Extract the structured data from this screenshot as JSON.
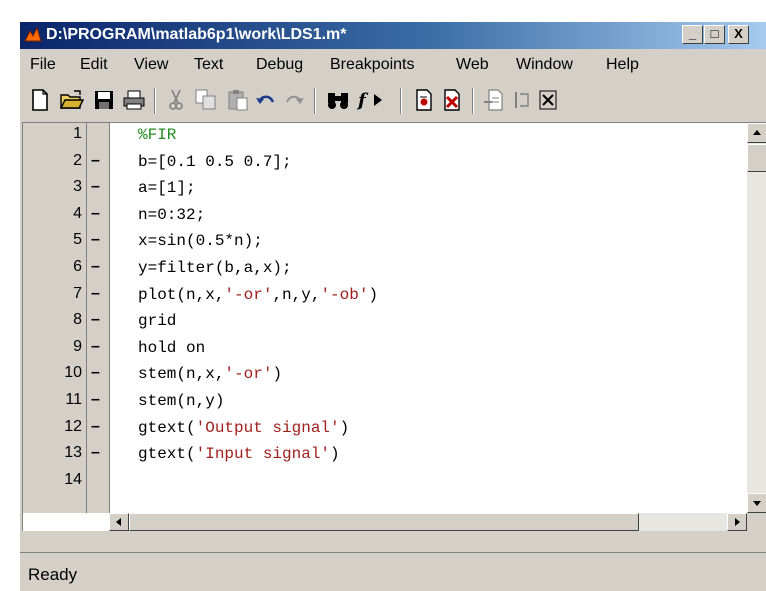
{
  "window": {
    "title": "D:\\PROGRAM\\matlab6p1\\work\\LDS1.m*",
    "minimize_label": "_",
    "maximize_label": "□",
    "close_label": "X"
  },
  "menu": [
    {
      "label": "File"
    },
    {
      "label": "Edit"
    },
    {
      "label": "View"
    },
    {
      "label": "Text"
    },
    {
      "label": "Debug"
    },
    {
      "label": "Breakpoints"
    },
    {
      "label": "Web"
    },
    {
      "label": "Window"
    },
    {
      "label": "Help"
    }
  ],
  "toolbar": {
    "buttons": [
      "new-file",
      "open-folder",
      "save",
      "print",
      "cut",
      "copy",
      "paste",
      "undo",
      "redo",
      "find",
      "function",
      "set-breakpoint",
      "clear-breakpoint",
      "step-in",
      "step-out"
    ]
  },
  "editor": {
    "lines": [
      {
        "num": "1",
        "mark": "",
        "code": [
          {
            "t": "%FIR",
            "c": "cmt"
          }
        ]
      },
      {
        "num": "2",
        "mark": "–",
        "code": [
          {
            "t": "b=[0.1 0.5 0.7];",
            "c": ""
          }
        ]
      },
      {
        "num": "3",
        "mark": "–",
        "code": [
          {
            "t": "a=[1];",
            "c": ""
          }
        ]
      },
      {
        "num": "4",
        "mark": "–",
        "code": [
          {
            "t": "n=0:32;",
            "c": ""
          }
        ]
      },
      {
        "num": "5",
        "mark": "–",
        "code": [
          {
            "t": "x=sin(0.5*n);",
            "c": ""
          }
        ]
      },
      {
        "num": "6",
        "mark": "–",
        "code": [
          {
            "t": "y=filter(b,a,x);",
            "c": ""
          }
        ]
      },
      {
        "num": "7",
        "mark": "–",
        "code": [
          {
            "t": "plot(n,x,",
            "c": ""
          },
          {
            "t": "'-or'",
            "c": "str"
          },
          {
            "t": ",n,y,",
            "c": ""
          },
          {
            "t": "'-ob'",
            "c": "str"
          },
          {
            "t": ")",
            "c": ""
          }
        ]
      },
      {
        "num": "8",
        "mark": "–",
        "code": [
          {
            "t": "grid",
            "c": ""
          }
        ]
      },
      {
        "num": "9",
        "mark": "–",
        "code": [
          {
            "t": "hold on",
            "c": ""
          }
        ]
      },
      {
        "num": "10",
        "mark": "–",
        "code": [
          {
            "t": "stem(n,x,",
            "c": ""
          },
          {
            "t": "'-or'",
            "c": "str"
          },
          {
            "t": ")",
            "c": ""
          }
        ]
      },
      {
        "num": "11",
        "mark": "–",
        "code": [
          {
            "t": "stem(n,y)",
            "c": ""
          }
        ]
      },
      {
        "num": "12",
        "mark": "–",
        "code": [
          {
            "t": "gtext(",
            "c": ""
          },
          {
            "t": "'Output signal'",
            "c": "str"
          },
          {
            "t": ")",
            "c": ""
          }
        ]
      },
      {
        "num": "13",
        "mark": "–",
        "code": [
          {
            "t": "gtext(",
            "c": ""
          },
          {
            "t": "'Input signal'",
            "c": "str"
          },
          {
            "t": ")",
            "c": ""
          }
        ]
      },
      {
        "num": "14",
        "mark": "",
        "code": []
      }
    ]
  },
  "status": {
    "text": "Ready"
  },
  "colors": {
    "comment": "#228b22",
    "string": "#a0201e",
    "titlebar_start": "#0a246a",
    "titlebar_end": "#a6caf0",
    "chrome": "#d4d0c8"
  }
}
